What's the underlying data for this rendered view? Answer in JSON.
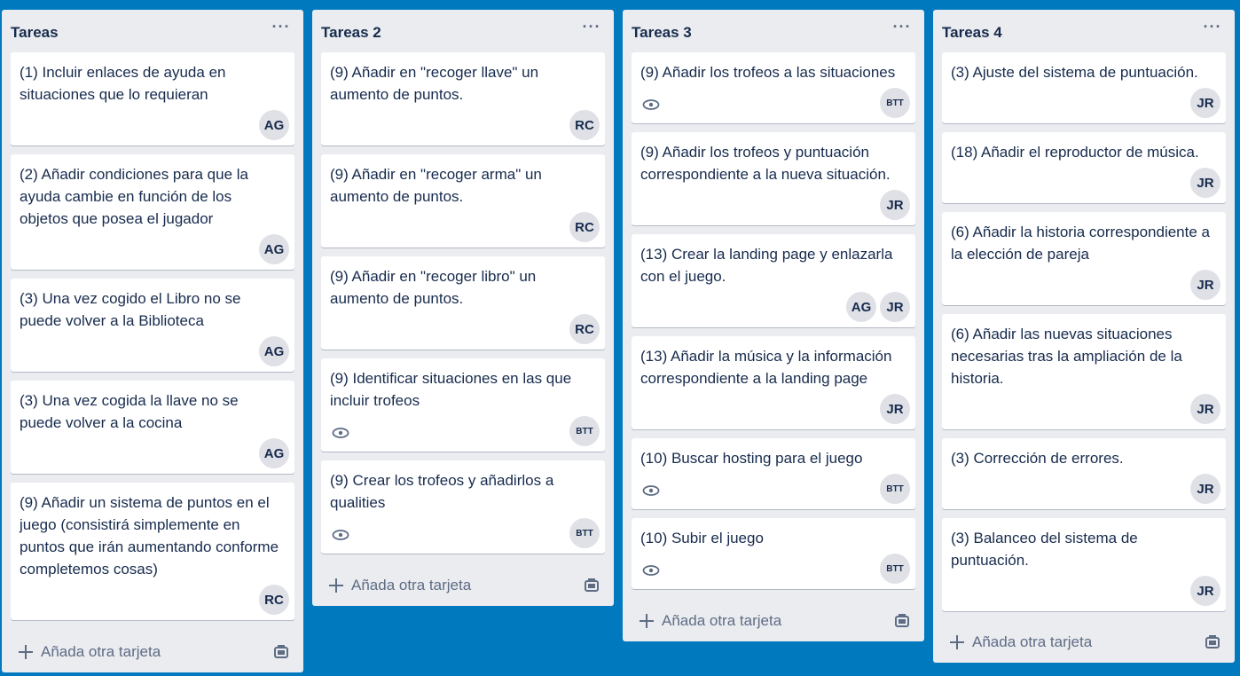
{
  "lists": [
    {
      "title": "Tareas",
      "menu": "···",
      "cards": [
        {
          "title": "(1) Incluir enlaces de ayuda en situaciones que lo requieran",
          "members": [
            "AG"
          ]
        },
        {
          "title": "(2) Añadir condiciones para que la ayuda cambie en función de los objetos que posea el jugador",
          "members": [
            "AG"
          ]
        },
        {
          "title": "(3) Una vez cogido el Libro no se puede volver a la Biblioteca",
          "members": [
            "AG"
          ]
        },
        {
          "title": "(3) Una vez cogida la llave no se puede volver a la cocina",
          "members": [
            "AG"
          ]
        },
        {
          "title": "(9) Añadir un sistema de puntos en el juego (consistirá simplemente en puntos que irán aumentando conforme completemos cosas)",
          "members": [
            "RC"
          ]
        }
      ],
      "add_label": "Añada otra tarjeta"
    },
    {
      "title": "Tareas 2",
      "menu": "···",
      "cards": [
        {
          "title": "(9) Añadir en \"recoger llave\" un aumento de puntos.",
          "members": [
            "RC"
          ]
        },
        {
          "title": "(9) Añadir en \"recoger arma\" un aumento de puntos.",
          "members": [
            "RC"
          ]
        },
        {
          "title": "(9) Añadir en \"recoger libro\" un aumento de puntos.",
          "members": [
            "RC"
          ]
        },
        {
          "title": "(9) Identificar situaciones en las que incluir trofeos",
          "members": [
            "BTT"
          ],
          "watch": true
        },
        {
          "title": "(9) Crear los trofeos y añadirlos a qualities",
          "members": [
            "BTT"
          ],
          "watch": true
        }
      ],
      "add_label": "Añada otra tarjeta"
    },
    {
      "title": "Tareas 3",
      "menu": "···",
      "cards": [
        {
          "title": "(9) Añadir los trofeos a las situaciones",
          "members": [
            "BTT"
          ],
          "watch": true
        },
        {
          "title": "(9) Añadir los trofeos y puntuación correspondiente a la nueva situación.",
          "members": [
            "JR"
          ]
        },
        {
          "title": "(13) Crear la landing page y enlazarla con el juego.",
          "members": [
            "AG",
            "JR"
          ]
        },
        {
          "title": "(13) Añadir la música y la información correspondiente a la landing page",
          "members": [
            "JR"
          ]
        },
        {
          "title": "(10) Buscar hosting para el juego",
          "members": [
            "BTT"
          ],
          "watch": true
        },
        {
          "title": "(10) Subir el juego",
          "members": [
            "BTT"
          ],
          "watch": true
        }
      ],
      "add_label": "Añada otra tarjeta"
    },
    {
      "title": "Tareas 4",
      "menu": "···",
      "cards": [
        {
          "title": "(3) Ajuste del sistema de puntuación.",
          "members": [
            "JR"
          ]
        },
        {
          "title": "(18) Añadir el reproductor de música.",
          "members": [
            "JR"
          ]
        },
        {
          "title": "(6) Añadir la historia correspondiente a la elección de pareja",
          "members": [
            "JR"
          ]
        },
        {
          "title": "(6) Añadir las nuevas situaciones necesarias tras la ampliación de la historia.",
          "members": [
            "JR"
          ]
        },
        {
          "title": "(3) Corrección de errores.",
          "members": [
            "JR"
          ]
        },
        {
          "title": "(3) Balanceo del sistema de puntuación.",
          "members": [
            "JR"
          ]
        }
      ],
      "add_label": "Añada otra tarjeta"
    }
  ],
  "colors": {
    "board_bg": "#0079bf",
    "list_bg": "#ebecf0",
    "avatar_bg": "#dfe1e6",
    "text": "#172b4d"
  }
}
